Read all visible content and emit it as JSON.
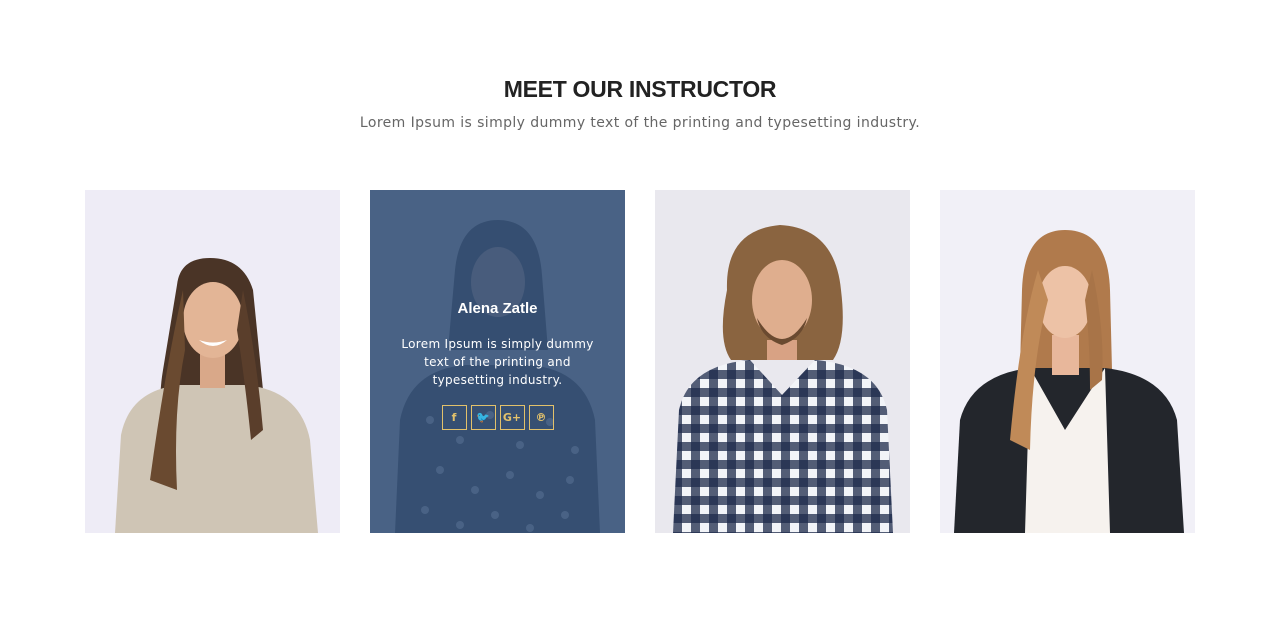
{
  "section": {
    "title": "MEET OUR INSTRUCTOR",
    "subtitle": "Lorem Ipsum is simply dummy text of the printing and typesetting industry."
  },
  "instructors": [
    {
      "photo_icon": "woman-sweater-photo"
    },
    {
      "photo_icon": "woman-polka-dot-photo",
      "name": "Alena Zatle",
      "bio": "Lorem Ipsum is simply dummy text of the printing and typesetting industry.",
      "socials": [
        {
          "icon": "facebook-icon",
          "glyph": "f"
        },
        {
          "icon": "twitter-icon",
          "glyph": "🐦"
        },
        {
          "icon": "google-plus-icon",
          "glyph": "G+"
        },
        {
          "icon": "pinterest-icon",
          "glyph": "℗"
        }
      ]
    },
    {
      "photo_icon": "man-plaid-shirt-photo"
    },
    {
      "photo_icon": "woman-leather-jacket-photo"
    }
  ],
  "colors": {
    "overlay": "#3e5a7e",
    "social_accent": "#e2c16b",
    "heading": "#222222",
    "subtitle": "#666666"
  }
}
